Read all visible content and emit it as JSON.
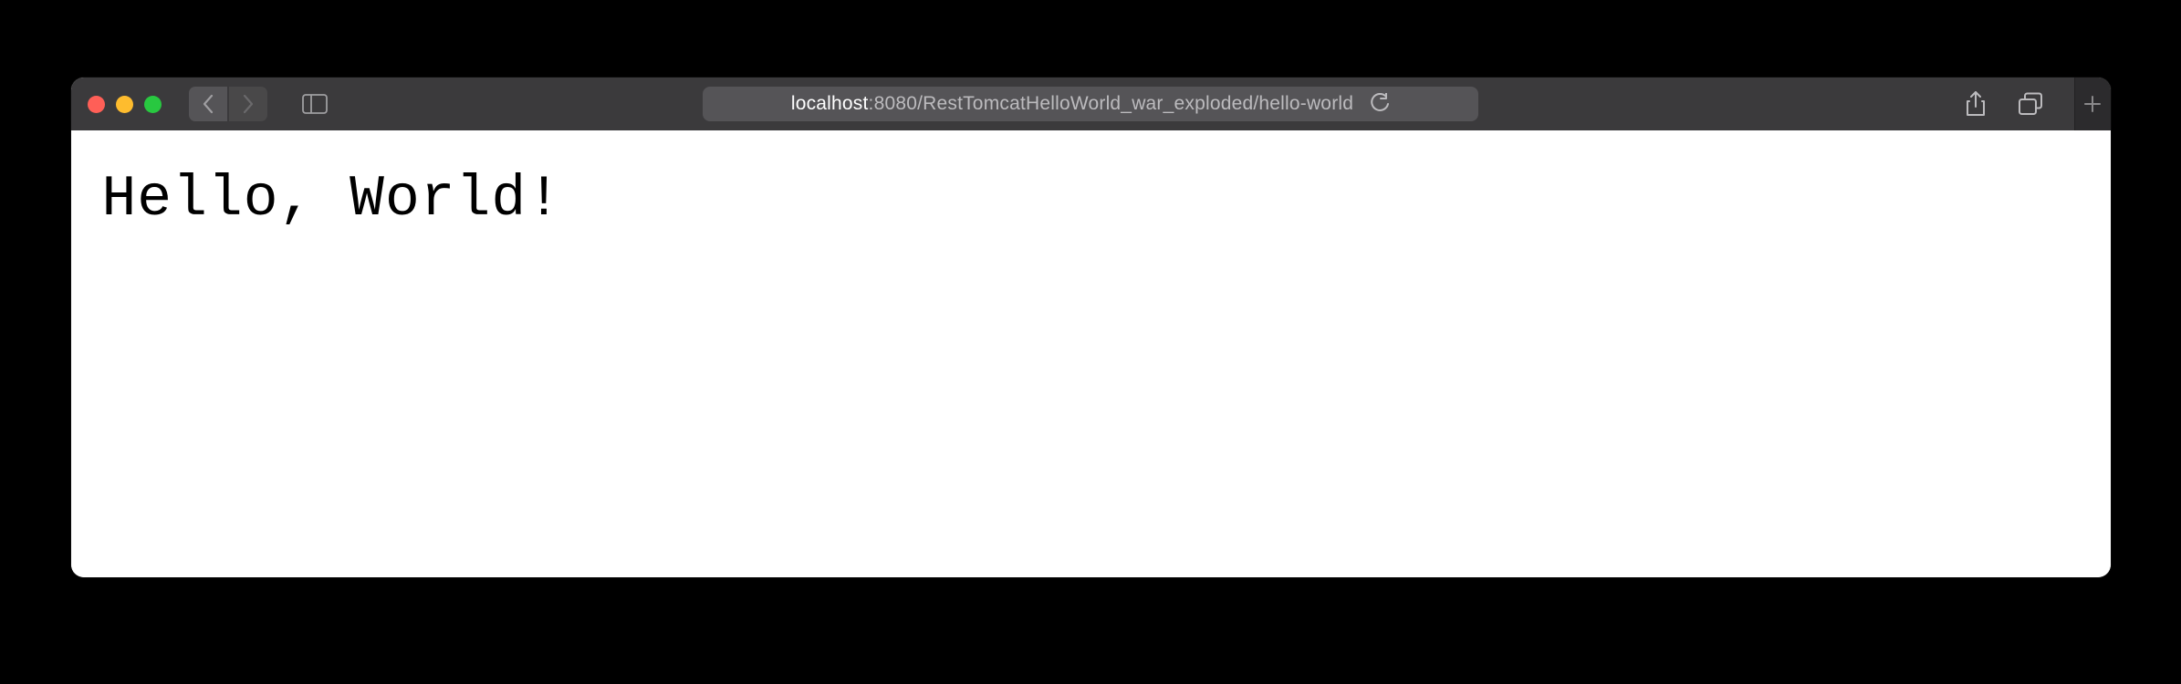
{
  "toolbar": {
    "url_host": "localhost",
    "url_path": ":8080/RestTomcatHelloWorld_war_exploded/hello-world"
  },
  "page": {
    "content": "Hello, World!"
  }
}
